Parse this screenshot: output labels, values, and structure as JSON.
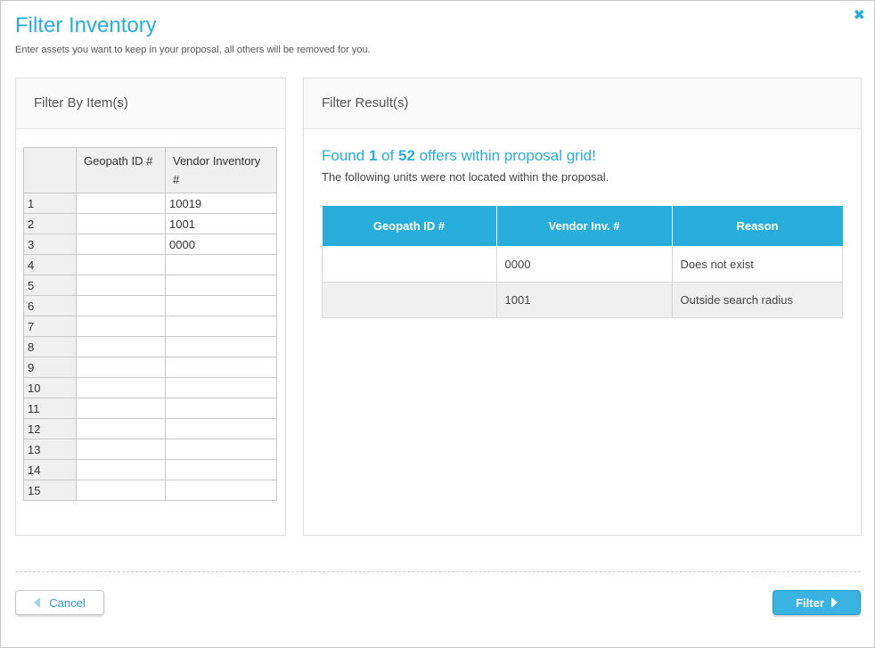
{
  "modal": {
    "title": "Filter Inventory",
    "subtitle": "Enter assets you want to keep in your proposal, all others will be removed for you.",
    "close_icon": "close-icon"
  },
  "left_panel": {
    "header": "Filter By Item(s)",
    "columns": [
      "Geopath ID #",
      "Vendor Inventory #"
    ],
    "rows": [
      {
        "num": "1",
        "geopath": "",
        "vendor": "10019"
      },
      {
        "num": "2",
        "geopath": "",
        "vendor": "1001"
      },
      {
        "num": "3",
        "geopath": "",
        "vendor": "0000"
      },
      {
        "num": "4",
        "geopath": "",
        "vendor": ""
      },
      {
        "num": "5",
        "geopath": "",
        "vendor": ""
      },
      {
        "num": "6",
        "geopath": "",
        "vendor": ""
      },
      {
        "num": "7",
        "geopath": "",
        "vendor": ""
      },
      {
        "num": "8",
        "geopath": "",
        "vendor": ""
      },
      {
        "num": "9",
        "geopath": "",
        "vendor": ""
      },
      {
        "num": "10",
        "geopath": "",
        "vendor": ""
      },
      {
        "num": "11",
        "geopath": "",
        "vendor": ""
      },
      {
        "num": "12",
        "geopath": "",
        "vendor": ""
      },
      {
        "num": "13",
        "geopath": "",
        "vendor": ""
      },
      {
        "num": "14",
        "geopath": "",
        "vendor": ""
      },
      {
        "num": "15",
        "geopath": "",
        "vendor": ""
      }
    ]
  },
  "right_panel": {
    "header": "Filter Result(s)",
    "found": {
      "prefix": "Found ",
      "found_count": "1",
      "middle": " of ",
      "total": "52",
      "suffix": " offers within proposal grid!"
    },
    "note": "The following units were not located within the proposal.",
    "columns": [
      "Geopath ID #",
      "Vendor Inv. #",
      "Reason"
    ],
    "rows": [
      {
        "geopath": "",
        "vendor": "0000",
        "reason": "Does not exist"
      },
      {
        "geopath": "",
        "vendor": "1001",
        "reason": "Outside search radius"
      }
    ]
  },
  "footer": {
    "cancel_label": "Cancel",
    "filter_label": "Filter"
  },
  "colors": {
    "accent": "#27aee0",
    "table_header": "#29aedc"
  }
}
